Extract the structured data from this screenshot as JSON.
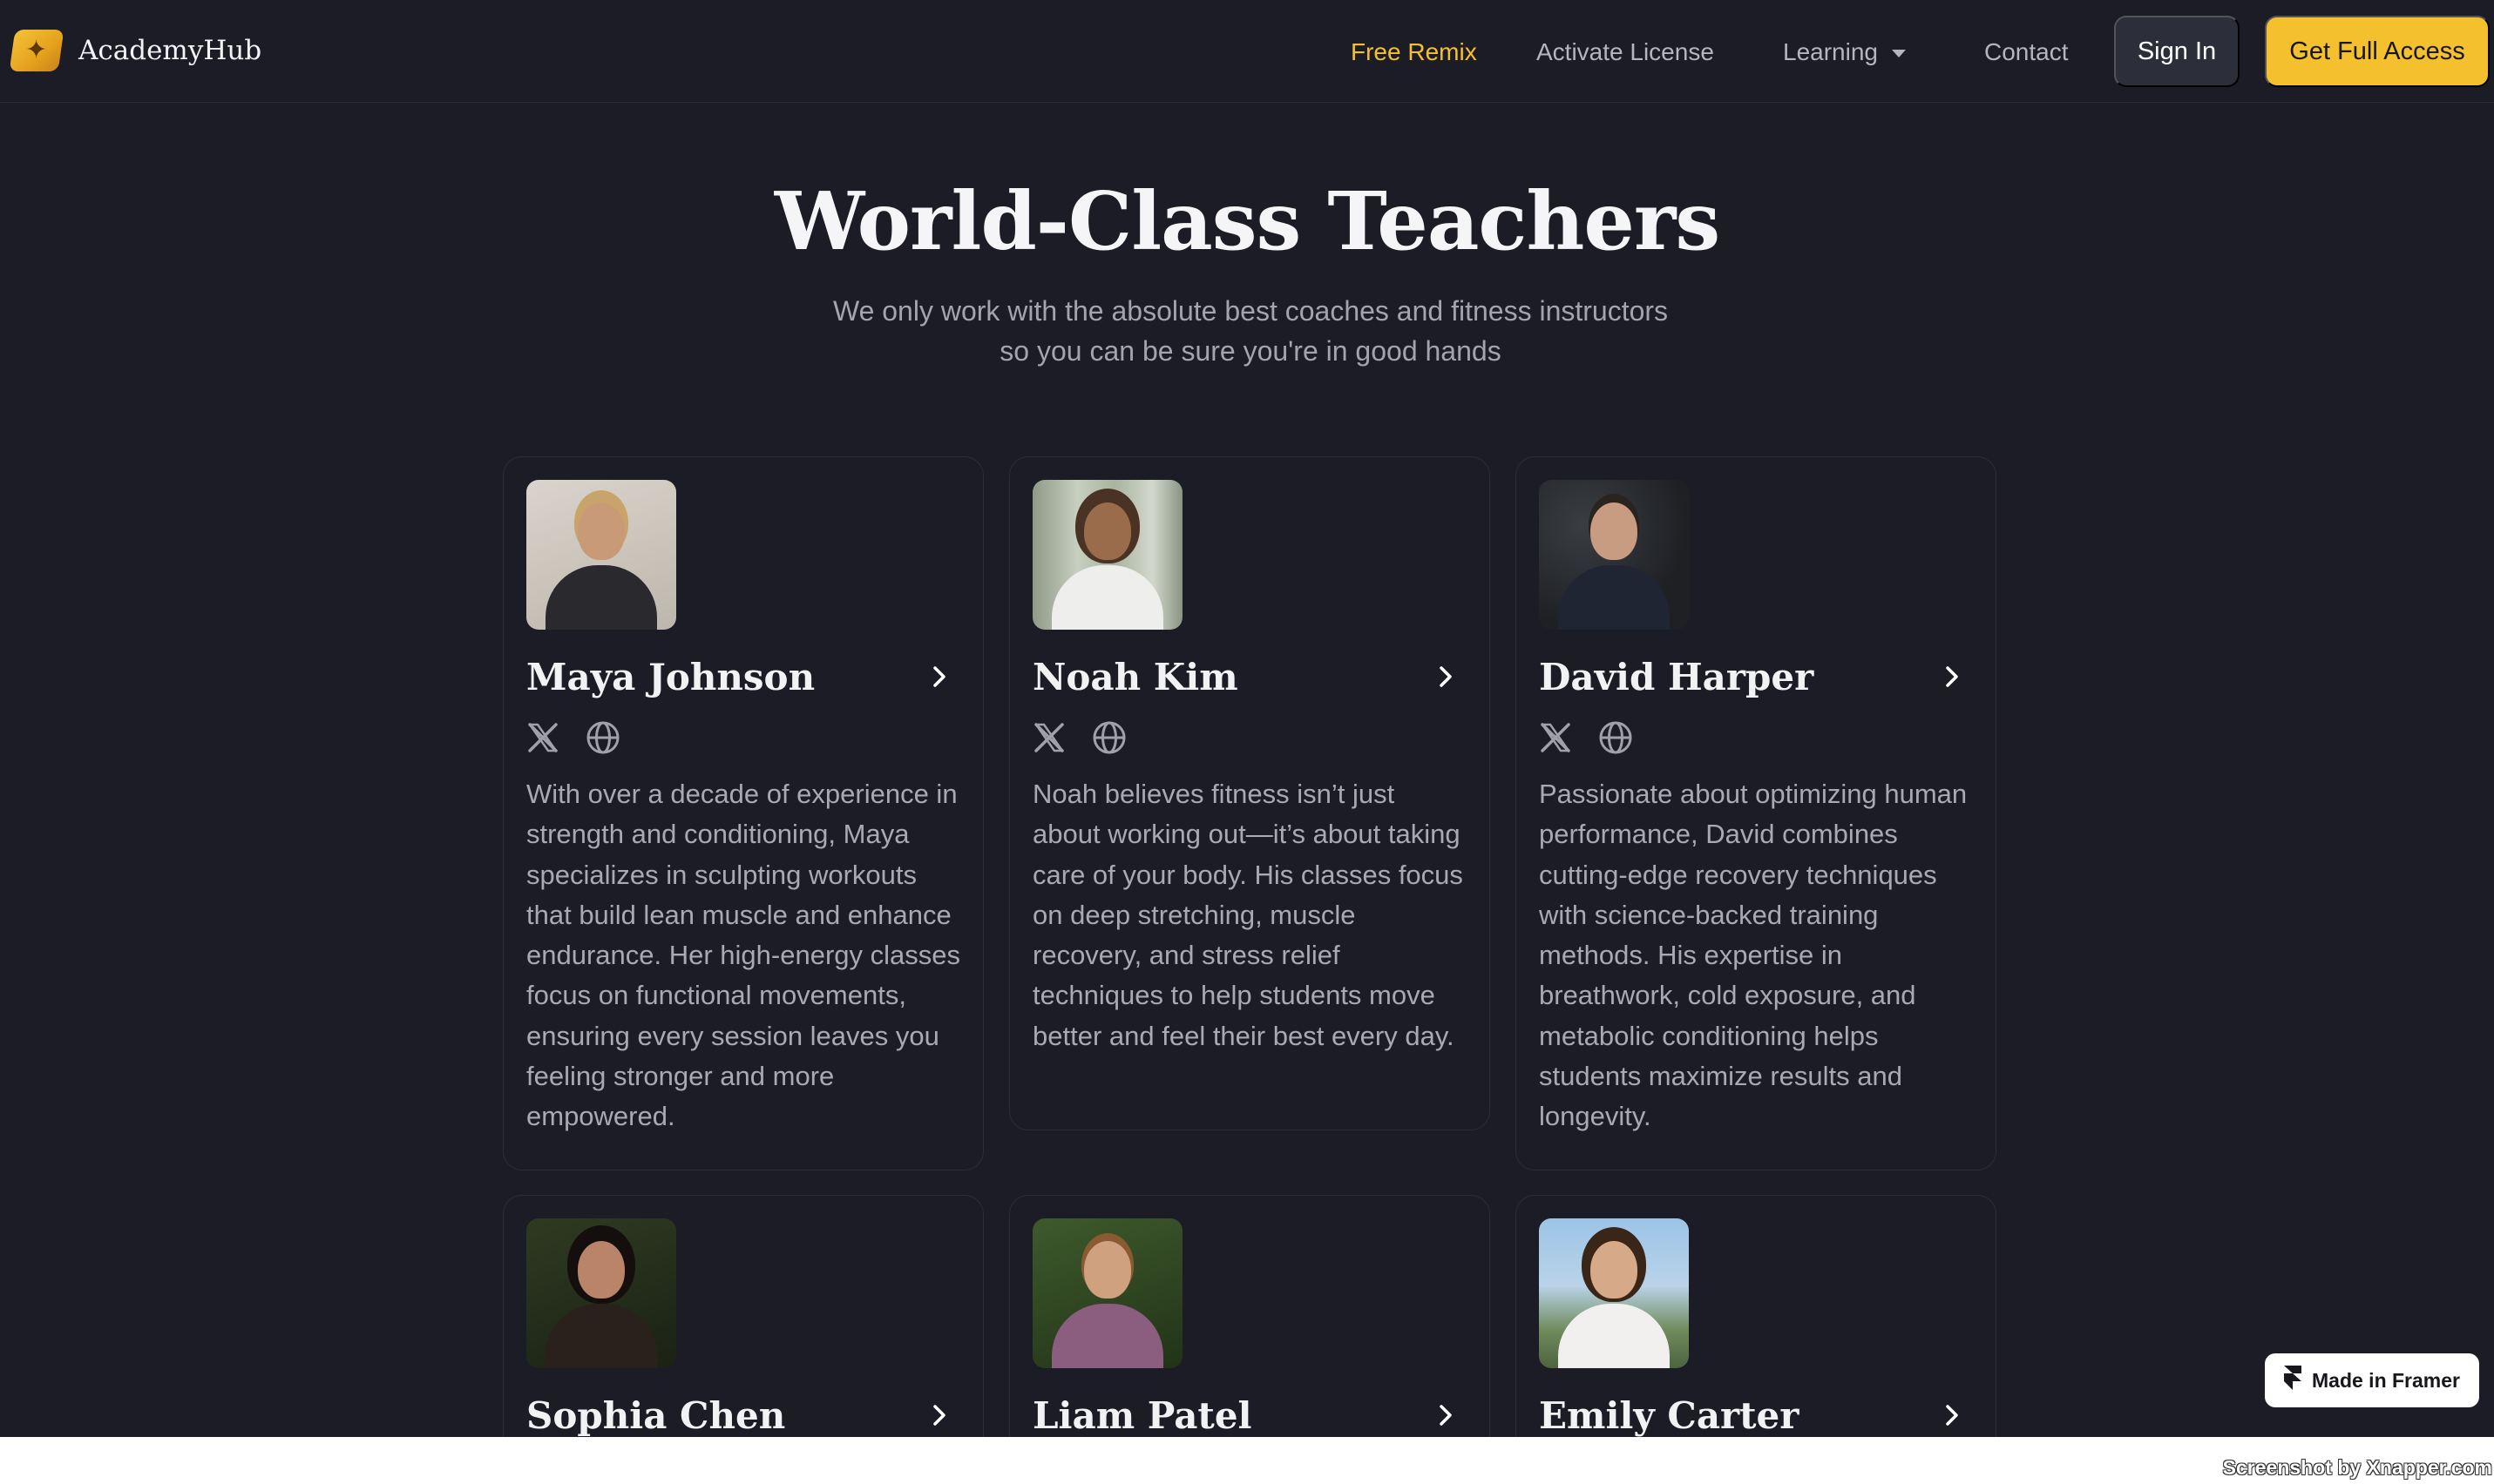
{
  "brand": {
    "name": "AcademyHub",
    "logo_glyph": "✦",
    "accent": "#f5c02e"
  },
  "nav": {
    "free_remix": "Free Remix",
    "activate_license": "Activate License",
    "learning": "Learning",
    "contact": "Contact",
    "sign_in": "Sign In",
    "get_full_access": "Get Full Access"
  },
  "hero": {
    "title": "World-Class Teachers",
    "subtitle_line1": "We only work with the absolute best coaches and fitness instructors",
    "subtitle_line2": "so you can be sure you're in good hands"
  },
  "teachers": [
    {
      "name": "Maya Johnson",
      "bio": "With over a decade of experience in strength and conditioning, Maya specializes in sculpting workouts that build lean muscle and enhance endurance. Her high-energy classes focus on functional movements, ensuring every session leaves you feeling stronger and more empowered.",
      "icons": [
        "x-icon",
        "globe-icon",
        "chevron-right-icon"
      ]
    },
    {
      "name": "Noah Kim",
      "bio": "Noah believes fitness isn’t just about working out—it’s about taking care of your body. His classes focus on deep stretching, muscle recovery, and stress relief techniques to help students move better and feel their best every day.",
      "icons": [
        "x-icon",
        "globe-icon",
        "chevron-right-icon"
      ]
    },
    {
      "name": "David Harper",
      "bio": "Passionate about optimizing human performance, David combines cutting-edge recovery techniques with science-backed training methods. His expertise in breathwork, cold exposure, and metabolic conditioning helps students maximize results and longevity.",
      "icons": [
        "x-icon",
        "globe-icon",
        "chevron-right-icon"
      ]
    },
    {
      "name": "Sophia Chen"
    },
    {
      "name": "Liam Patel"
    },
    {
      "name": "Emily Carter"
    }
  ],
  "framer_badge": {
    "label": "Made in Framer"
  },
  "watermark": "Screenshot by Xnapper.com"
}
